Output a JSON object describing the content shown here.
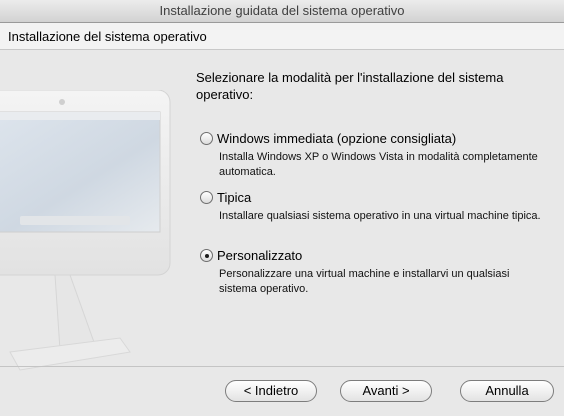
{
  "window": {
    "title": "Installazione guidata del sistema operativo"
  },
  "header": {
    "title": "Installazione del sistema operativo"
  },
  "illustration": {
    "icon": "imac-icon"
  },
  "prompt": "Selezionare la modalità per l'installazione del sistema operativo:",
  "options": [
    {
      "label": "Windows immediata (opzione consigliata)",
      "description": "Installa Windows XP o Windows Vista in modalità completamente automatica.",
      "checked": false
    },
    {
      "label": "Tipica",
      "description": "Installare qualsiasi sistema operativo in una virtual machine tipica.",
      "checked": false
    },
    {
      "label": "Personalizzato",
      "description": "Personalizzare una virtual machine e installarvi un qualsiasi sistema operativo.",
      "checked": true
    }
  ],
  "buttons": {
    "back": "< Indietro",
    "next": "Avanti >",
    "cancel": "Annulla"
  }
}
